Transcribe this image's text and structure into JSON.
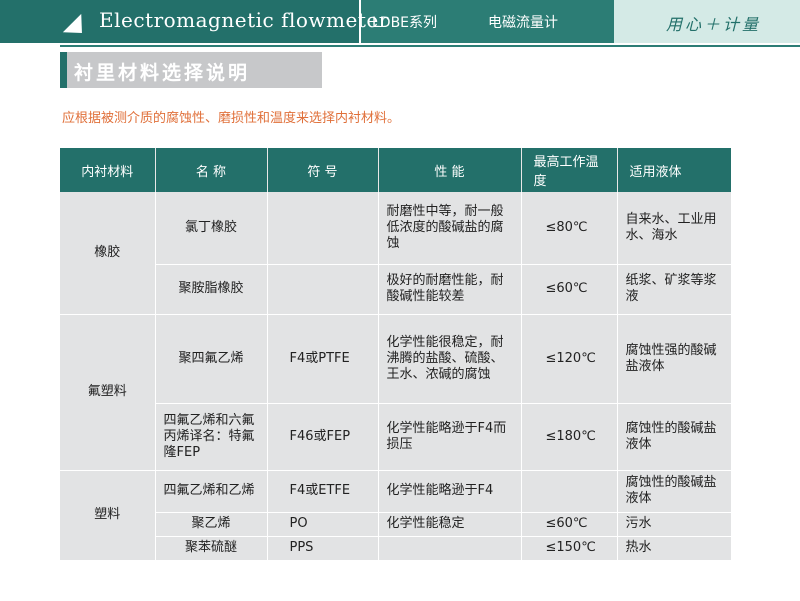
{
  "header": {
    "title": "Electromagnetic  flowmeter",
    "series": "LDBE系列",
    "product": "电磁流量计",
    "slogan": "用心＋计量"
  },
  "section": {
    "title": "衬里材料选择说明"
  },
  "intro": "应根据被测介质的腐蚀性、磨损性和温度来选择内衬材料。",
  "table": {
    "headers": [
      "内衬材料",
      "名 称",
      "符 号",
      "性 能",
      "最高工作温度",
      "适用液体"
    ],
    "groups": [
      "橡胶",
      "氟塑料",
      "塑料"
    ],
    "rows": [
      {
        "name": "氯丁橡胶",
        "symbol": "",
        "performance": "耐磨性中等，耐一般低浓度的酸碱盐的腐蚀",
        "temp": "≤80℃",
        "liquid": "自来水、工业用水、海水"
      },
      {
        "name": "聚胺脂橡胶",
        "symbol": "",
        "performance": "极好的耐磨性能，耐酸碱性能较差",
        "temp": "≤60℃",
        "liquid": "纸浆、矿浆等浆液"
      },
      {
        "name": "聚四氟乙烯",
        "symbol": "F4或PTFE",
        "performance": "化学性能很稳定，耐沸腾的盐酸、硫酸、王水、浓碱的腐蚀",
        "temp": "≤120℃",
        "liquid": "腐蚀性强的酸碱盐液体"
      },
      {
        "name": "四氟乙烯和六氟丙烯译名：特氟隆FEP",
        "symbol": "F46或FEP",
        "performance": "化学性能略逊于F4而损压",
        "temp": "≤180℃",
        "liquid": "腐蚀性的酸碱盐液体"
      },
      {
        "name": "四氟乙烯和乙烯",
        "symbol": "F4或ETFE",
        "performance": "化学性能略逊于F4",
        "temp": "",
        "liquid": "腐蚀性的酸碱盐液体"
      },
      {
        "name": "聚乙烯",
        "symbol": "PO",
        "performance": "化学性能稳定",
        "temp": "≤60℃",
        "liquid": "污水"
      },
      {
        "name": "聚苯硫醚",
        "symbol": "PPS",
        "performance": "",
        "temp": "≤150℃",
        "liquid": "热水"
      }
    ]
  },
  "colors": {
    "brand_dark": "#23706a",
    "brand_mid": "#2c7d75",
    "brand_light": "#d4eae6",
    "section_gray": "#c7c8ca",
    "intro_orange": "#e0703a",
    "cell_gray": "#e2e3e4"
  }
}
